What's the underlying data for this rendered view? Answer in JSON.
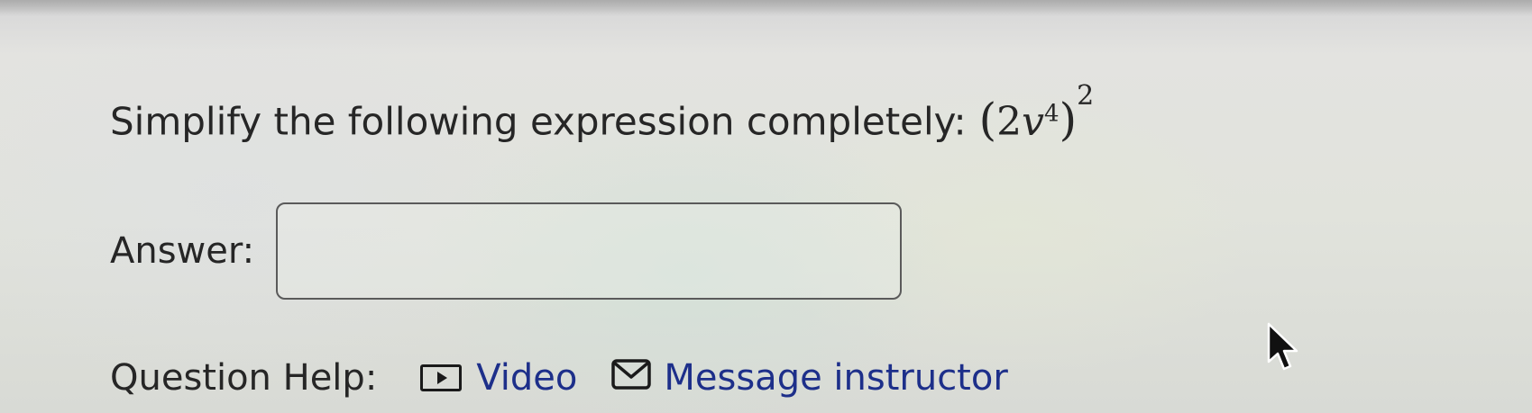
{
  "question": {
    "prompt": "Simplify the following expression completely:",
    "expression": {
      "open_paren": "(",
      "coefficient": "2",
      "variable": "v",
      "inner_exponent": "4",
      "close_paren": ")",
      "outer_exponent": "2"
    }
  },
  "answer": {
    "label": "Answer:",
    "value": "",
    "placeholder": ""
  },
  "help": {
    "label": "Question Help:",
    "video": {
      "icon": "video-play-icon",
      "label": "Video"
    },
    "message": {
      "icon": "envelope-icon",
      "label": "Message instructor"
    }
  },
  "colors": {
    "link": "#1d2f8a",
    "text": "#262626",
    "input_border": "#5a5a5a"
  }
}
